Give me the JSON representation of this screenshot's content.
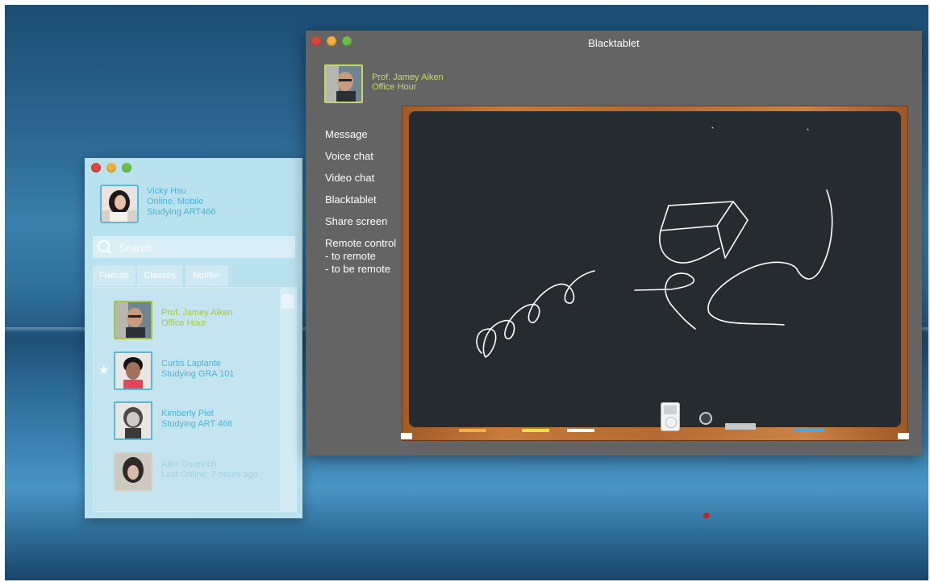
{
  "friends_window": {
    "profile": {
      "name": "Vicky Hsu",
      "status": "Online, Mobile",
      "activity": "Studying ART466"
    },
    "search": {
      "placeholder": "Search"
    },
    "tabs": [
      {
        "label": "Friends"
      },
      {
        "label": "Classes"
      },
      {
        "label": "Notifier"
      }
    ],
    "friends": [
      {
        "name": "Prof. Jamey Aiken",
        "status": "Office Hour",
        "color": "#a8c63a",
        "favorite": false
      },
      {
        "name": "Curtis Laplante",
        "status": "Studying GRA 101",
        "color": "#4ab4d8",
        "favorite": true
      },
      {
        "name": "Kimberly Piet",
        "status": "Studying ART 466",
        "color": "#4ab4d8",
        "favorite": false
      },
      {
        "name": "Alex Gurevich",
        "status": "Last Online: 7 hours ago",
        "color": "#9fd0e2",
        "favorite": false
      }
    ]
  },
  "blacktablet_window": {
    "title": "Blacktablet",
    "host": {
      "name": "Prof. Jamey Aiken",
      "status": "Office Hour"
    },
    "menu": [
      {
        "label": "Message"
      },
      {
        "label": "Voice chat"
      },
      {
        "label": "Video chat"
      },
      {
        "label": "Blacktablet"
      },
      {
        "label": "Share screen"
      },
      {
        "label": "Remote control"
      },
      {
        "label": "- to remote"
      },
      {
        "label": "- to be remote"
      }
    ],
    "chalk_colors": [
      "#f0b048",
      "#ece14a",
      "#ffffff",
      "#49a9e6"
    ]
  },
  "icons": {
    "favorite": "star-icon",
    "search": "search-icon"
  },
  "colors": {
    "accent_blue": "#4ab4d8",
    "accent_green": "#a8c63a",
    "board": "#262b30"
  }
}
